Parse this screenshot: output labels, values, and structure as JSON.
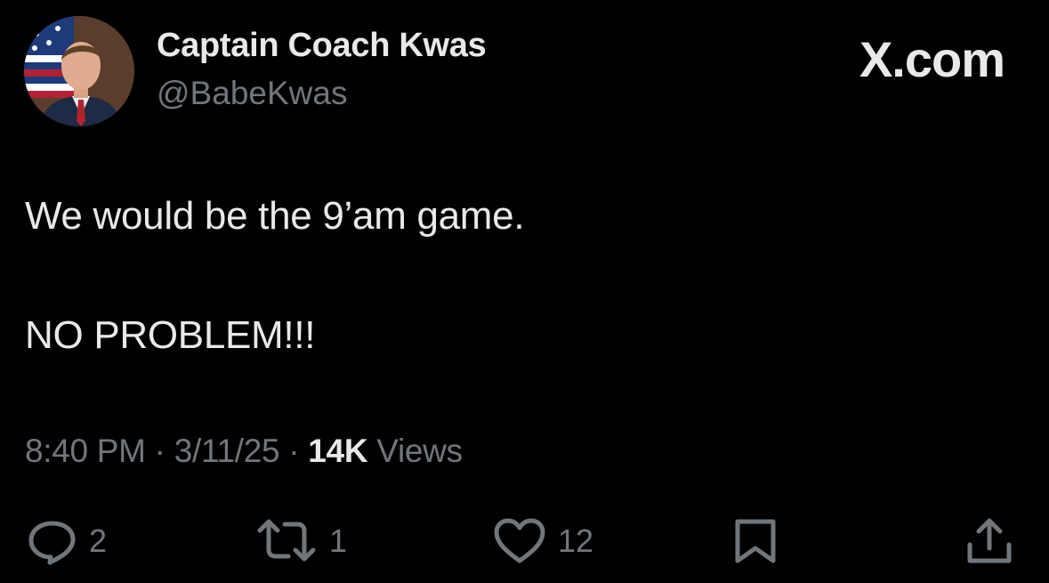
{
  "author": {
    "display_name": "Captain Coach Kwas",
    "handle": "@BabeKwas",
    "avatar_icon": "profile-photo"
  },
  "brand": "X.com",
  "tweet": {
    "line1": "We would be the 9’am game.",
    "line2": "NO PROBLEM!!!"
  },
  "meta": {
    "time": "8:40 PM",
    "sep1": " · ",
    "date": "3/11/25",
    "sep2": " · ",
    "views_count": "14K",
    "views_label": " Views"
  },
  "actions": {
    "reply": {
      "icon": "reply-icon",
      "count": "2"
    },
    "repost": {
      "icon": "repost-icon",
      "count": "1"
    },
    "like": {
      "icon": "heart-icon",
      "count": "12"
    },
    "bookmark": {
      "icon": "bookmark-icon"
    },
    "share": {
      "icon": "share-icon"
    }
  },
  "colors": {
    "background": "#000000",
    "primary_text": "#e7e9ea",
    "secondary_text": "#71767b"
  }
}
